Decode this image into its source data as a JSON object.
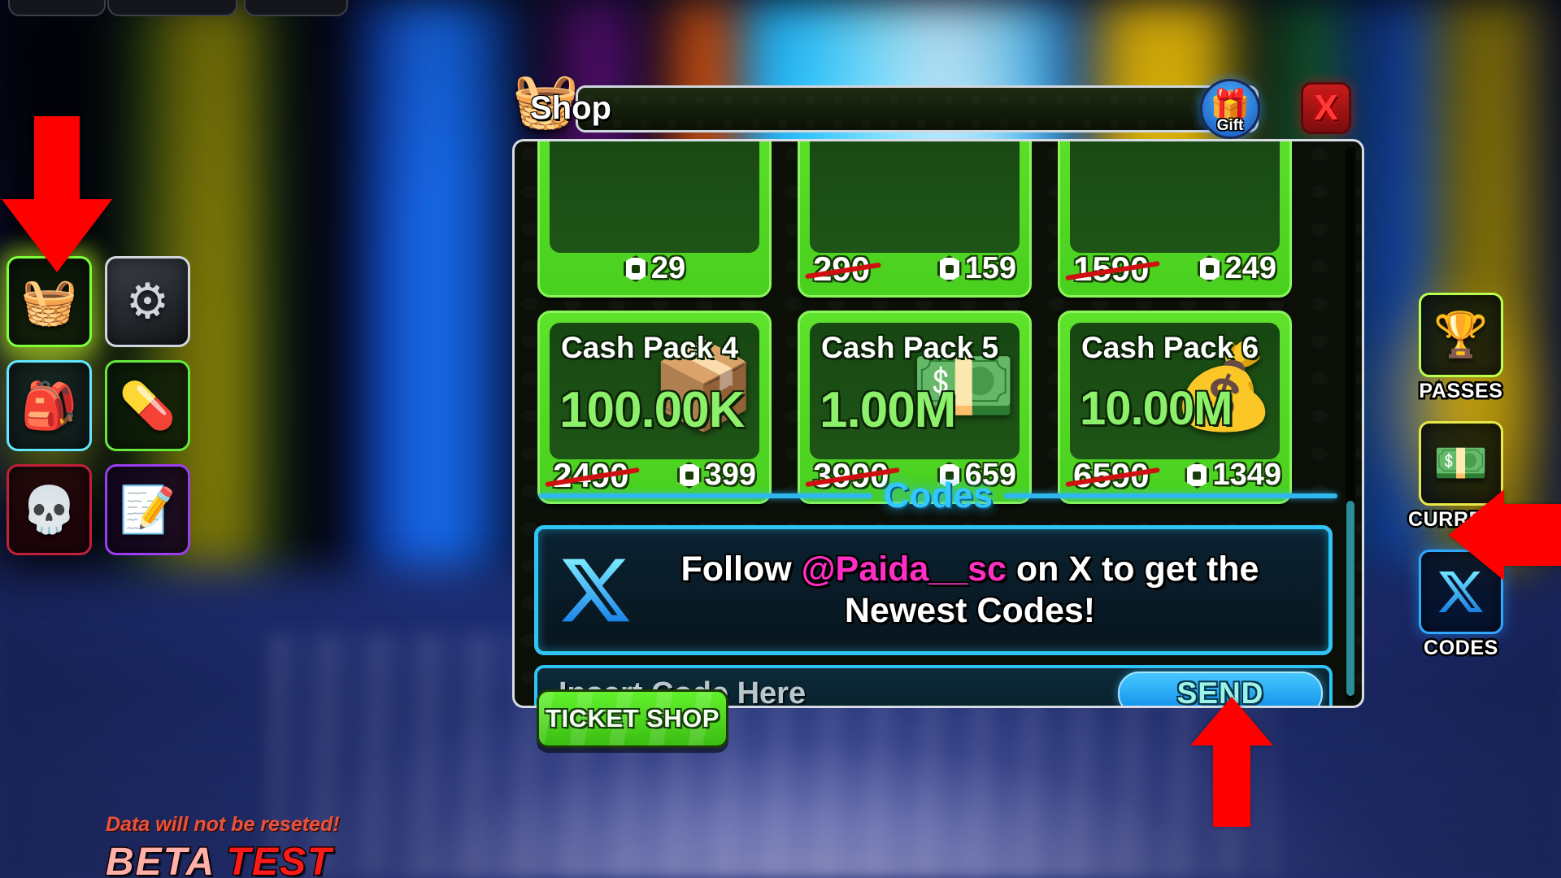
{
  "window_title": "Shop",
  "icons": {
    "shop": "shopping-basket-icon",
    "gift": "gift-icon",
    "close": "close-icon",
    "gear": "gear-icon",
    "backpack": "backpack-icon",
    "pill": "pill-icon",
    "skull": "skull-icon",
    "notepad": "notepad-icon",
    "trophy": "trophy-icon",
    "money": "money-stack-icon",
    "x_logo": "x-twitter-icon",
    "robux": "robux-icon"
  },
  "titlebar": {
    "title": "Shop",
    "gift_label": "Gift",
    "close_label": "X"
  },
  "shop": {
    "top_row_partial": [
      {
        "old_price": "",
        "new_price": "29"
      },
      {
        "old_price": "290",
        "new_price": "159"
      },
      {
        "old_price": "1590",
        "new_price": "249"
      }
    ],
    "packs": [
      {
        "name": "Cash Pack 4",
        "amount": "100.00K",
        "old_price": "2490",
        "new_price": "399",
        "art": "📦"
      },
      {
        "name": "Cash Pack 5",
        "amount": "1.00M",
        "old_price": "3990",
        "new_price": "659",
        "art": "💵"
      },
      {
        "name": "Cash Pack 6",
        "amount": "10.00M",
        "old_price": "6590",
        "new_price": "1349",
        "art": "💰"
      }
    ],
    "codes_section_title": "Codes",
    "follow_prefix": "Follow ",
    "follow_handle": "@Paida__sc",
    "follow_suffix": " on X to get the Newest Codes!",
    "code_input_placeholder": "Insert Code Here",
    "send_button": "SEND",
    "ticket_shop_button": "TICKET SHOP"
  },
  "right_buttons": [
    {
      "label": "PASSES",
      "icon": "trophy-icon"
    },
    {
      "label": "CURRENCY",
      "icon": "money-stack-icon"
    },
    {
      "label": "CODES",
      "icon": "x-twitter-icon"
    }
  ],
  "left_icons": [
    {
      "name": "shop",
      "glyph": "🧺"
    },
    {
      "name": "settings",
      "glyph": "⚙"
    },
    {
      "name": "backpack",
      "glyph": "🎒"
    },
    {
      "name": "pill",
      "glyph": "💊"
    },
    {
      "name": "skull",
      "glyph": "💀"
    },
    {
      "name": "notes",
      "glyph": "📝"
    }
  ],
  "beta": {
    "sub": "Data will not be reseted!",
    "word1": "BETA",
    "word2": "TEST"
  },
  "colors": {
    "accent_cyan": "#2fc4f5",
    "accent_green": "#5ee22c",
    "accent_pink": "#ff2ec4",
    "accent_red": "#ff1a1a",
    "highlight_arrow": "#ff0000"
  }
}
